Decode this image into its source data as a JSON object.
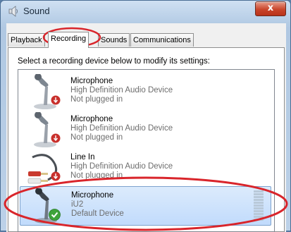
{
  "window": {
    "title": "Sound",
    "close_glyph": "x",
    "icon": "speaker-icon"
  },
  "tabs": [
    {
      "label": "Playback",
      "active": false
    },
    {
      "label": "Recording",
      "active": true
    },
    {
      "label": "Sounds",
      "active": false
    },
    {
      "label": "Communications",
      "active": false
    }
  ],
  "instruction": "Select a recording device below to modify its settings:",
  "devices": [
    {
      "name": "Microphone",
      "description": "High Definition Audio Device",
      "status": "Not plugged in",
      "icon": "microphone-icon",
      "badge": "unplugged",
      "selected": false
    },
    {
      "name": "Microphone",
      "description": "High Definition Audio Device",
      "status": "Not plugged in",
      "icon": "microphone-icon",
      "badge": "unplugged",
      "selected": false
    },
    {
      "name": "Line In",
      "description": "High Definition Audio Device",
      "status": "Not plugged in",
      "icon": "line-in-cable-icon",
      "badge": "unplugged",
      "selected": false
    },
    {
      "name": "Microphone",
      "description": "iU2",
      "status": "Default Device",
      "icon": "microphone-icon",
      "badge": "default-checkmark",
      "selected": true
    }
  ],
  "colors": {
    "annotation": "#d9252b",
    "selection": "#c1dbfc",
    "default_badge": "#3ea33a",
    "unplugged_badge": "#c8302c"
  }
}
